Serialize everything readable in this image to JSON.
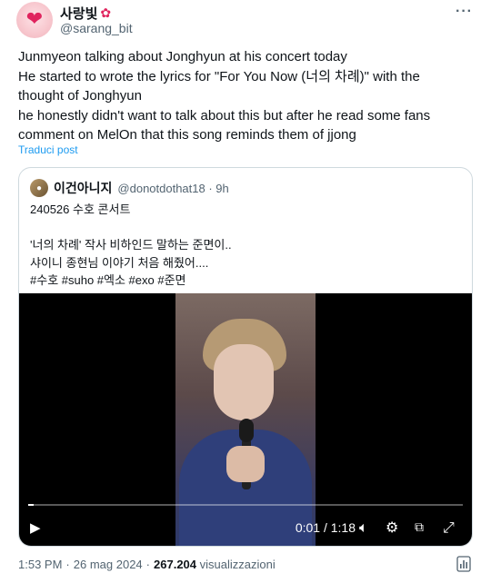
{
  "author": {
    "display_name": "사랑빛",
    "name_emoji": "✿",
    "handle": "@sarang_bit",
    "avatar_glyph": "❤"
  },
  "more_icon": "···",
  "tweet_lines": [
    "Junmyeon talking about Jonghyun at his concert today",
    "He started to wrote the lyrics for \"For You Now (너의 차례)\" with the",
    "thought of Jonghyun",
    "he honestly didn't want to talk about this but after he read some fans",
    "comment on MelOn that this song reminds them of jjong"
  ],
  "translate_label": "Traduci post",
  "quote": {
    "display_name": "이건아니지",
    "handle_time": "@donotdothat18 · 9h",
    "lines": [
      "240526 수호 콘서트",
      "",
      "'너의 차례' 작사 비하인드 말하는 준면이..",
      "샤이니 종현님 이야기 처음 해줬어....",
      "#수호 #suho #엑소 #exo #준면"
    ]
  },
  "video": {
    "timecode": "0:01 / 1:18",
    "progress_fraction": 0.013,
    "icons": {
      "play": "play-icon",
      "volume": "volume-icon",
      "settings": "settings-icon",
      "pip": "picture-in-picture-icon",
      "fullscreen": "fullscreen-icon"
    }
  },
  "meta": {
    "time": "1:53 PM",
    "date": "26 mag 2024",
    "views_count": "267.204",
    "views_label": "visualizzazioni"
  },
  "colors": {
    "accent": "#1d9bf0",
    "muted": "#536471",
    "heart": "#e0245e"
  }
}
